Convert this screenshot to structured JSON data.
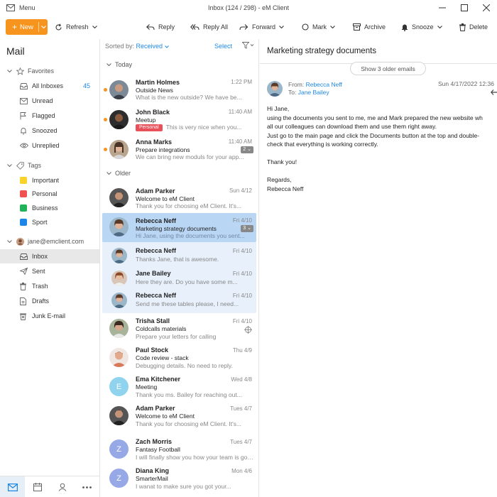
{
  "window": {
    "menu_label": "Menu",
    "title": "Inbox (124 / 298) - eM Client"
  },
  "toolbar": {
    "new_label": "New",
    "refresh_label": "Refresh",
    "reply_label": "Reply",
    "reply_all_label": "Reply All",
    "forward_label": "Forward",
    "mark_label": "Mark",
    "archive_label": "Archive",
    "snooze_label": "Snooze",
    "delete_label": "Delete"
  },
  "sidebar": {
    "heading": "Mail",
    "favorites_label": "Favorites",
    "favorites": [
      {
        "label": "All Inboxes",
        "count": "45",
        "icon": "inbox-icon"
      },
      {
        "label": "Unread",
        "icon": "unread-icon"
      },
      {
        "label": "Flagged",
        "icon": "flag-icon"
      },
      {
        "label": "Snoozed",
        "icon": "snooze-icon"
      },
      {
        "label": "Unreplied",
        "icon": "eye-icon"
      }
    ],
    "tags_label": "Tags",
    "tags": [
      {
        "label": "Important",
        "color": "#f9d22a"
      },
      {
        "label": "Personal",
        "color": "#ef5050"
      },
      {
        "label": "Business",
        "color": "#21b35a"
      },
      {
        "label": "Sport",
        "color": "#1b86e8"
      }
    ],
    "account_label": "jane@emclient.com",
    "folders": [
      {
        "label": "Inbox",
        "icon": "inbox-icon"
      },
      {
        "label": "Sent",
        "icon": "send-icon"
      },
      {
        "label": "Trash",
        "icon": "trash-icon"
      },
      {
        "label": "Drafts",
        "icon": "drafts-icon"
      },
      {
        "label": "Junk E-mail",
        "icon": "junk-icon"
      }
    ]
  },
  "list": {
    "sorted_label": "Sorted by:",
    "sorted_value": "Received",
    "select_label": "Select",
    "group_today": "Today",
    "group_older": "Older",
    "messages": [
      {
        "from": "Martin Holmes",
        "date": "1:22 PM",
        "subject": "Outside News",
        "preview": "What is the new outside? We have be...",
        "unread": true
      },
      {
        "from": "John Black",
        "date": "11:40 AM",
        "tag": "Personal",
        "subject": "Meetup",
        "preview": "This is very nice when you...",
        "unread": true
      },
      {
        "from": "Anna Marks",
        "date": "11:40 AM",
        "subject": "Prepare integrations",
        "preview": "We can bring new moduls for your app...",
        "count": "2",
        "unread": true
      },
      {
        "from": "Adam Parker",
        "date": "Sun 4/12",
        "subject": "Welcome to eM Client",
        "preview": "Thank you for choosing eM Client. It's..."
      },
      {
        "from": "Rebecca Neff",
        "date": "Fri 4/10",
        "subject": "Marketing strategy documents",
        "preview": "Hi Jane, using the documents you sent...",
        "count": "3"
      },
      {
        "from": "Rebecca Neff",
        "date": "Fri 4/10",
        "preview": "Thanks Jane, that is awesome."
      },
      {
        "from": "Jane Bailey",
        "date": "Fri 4/10",
        "preview": "Here they are. Do you have some m..."
      },
      {
        "from": "Rebecca Neff",
        "date": "Fri 4/10",
        "preview": "Send me these tables please, I need..."
      },
      {
        "from": "Trisha Stall",
        "date": "Fri 4/10",
        "subject": "Coldcalls materials",
        "preview": "Prepare your letters for calling"
      },
      {
        "from": "Paul Stock",
        "date": "Thu 4/9",
        "subject": "Code review - stack",
        "preview": "Debugging details. No need to reply."
      },
      {
        "from": "Ema Kitchener",
        "date": "Wed 4/8",
        "subject": "Meeting",
        "preview": "Thank you ms. Bailey for reaching out...",
        "initial": "E"
      },
      {
        "from": "Adam Parker",
        "date": "Tues 4/7",
        "subject": "Welcome to eM Client",
        "preview": "Thank you for choosing eM Client. It's..."
      },
      {
        "from": "Zach Morris",
        "date": "Tues 4/7",
        "subject": "Fantasy Football",
        "preview": "I will finally show you how your team is going...",
        "initial": "Z"
      },
      {
        "from": "Diana King",
        "date": "Mon 4/6",
        "subject": "SmarterMail",
        "preview": "I wanat to make sure you got your...",
        "initial": "Z"
      }
    ]
  },
  "reader": {
    "subject": "Marketing strategy documents",
    "show_older_label": "Show 3 older emails",
    "from_label": "From:",
    "from_name": "Rebecca Neff",
    "to_label": "To:",
    "to_name": "Jane Bailey",
    "date": "Sun 4/17/2022 12:36",
    "body": {
      "greeting": "Hi Jane,",
      "line1": "using the documents you sent to me, me and Mark prepared the new website wh",
      "line2": "all our colleagues can download them and use them right away.",
      "line3": "Just go to the main page and click the Documents button at the top and double-",
      "line4": "check that everything is working correctly.",
      "thanks": "Thank you!",
      "regards": "Regards,",
      "signature": "Rebecca Neff"
    }
  },
  "colors": {
    "accent": "#1e88e5",
    "new_button": "#f7941d",
    "unread_dot": "#f7941d",
    "selected_row": "#b9d6f4",
    "thread_bg": "#e7f0fb"
  }
}
